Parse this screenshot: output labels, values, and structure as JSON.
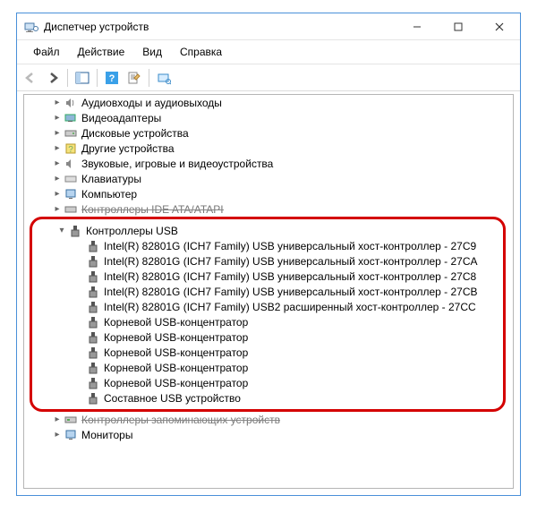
{
  "window": {
    "title": "Диспетчер устройств"
  },
  "menu": {
    "file": "Файл",
    "action": "Действие",
    "view": "Вид",
    "help": "Справка"
  },
  "tree": {
    "cat_audio": "Аудиовходы и аудиовыходы",
    "cat_video": "Видеоадаптеры",
    "cat_disk": "Дисковые устройства",
    "cat_other": "Другие устройства",
    "cat_sound": "Звуковые, игровые и видеоустройства",
    "cat_keyboard": "Клавиатуры",
    "cat_computer": "Компьютер",
    "cat_ide": "Контроллеры IDE ATA/ATAPI",
    "cat_usb": "Контроллеры USB",
    "cat_storage": "Контроллеры запоминающих устройств",
    "cat_monitor": "Мониторы",
    "usb_children": [
      "Intel(R) 82801G (ICH7 Family) USB универсальный хост-контроллер  - 27C9",
      "Intel(R) 82801G (ICH7 Family) USB универсальный хост-контроллер  - 27CA",
      "Intel(R) 82801G (ICH7 Family) USB универсальный хост-контроллер  - 27C8",
      "Intel(R) 82801G (ICH7 Family) USB универсальный хост-контроллер  - 27CB",
      "Intel(R) 82801G (ICH7 Family) USB2 расширенный хост-контроллер  - 27CC",
      "Корневой USB-концентратор",
      "Корневой USB-концентратор",
      "Корневой USB-концентратор",
      "Корневой USB-концентратор",
      "Корневой USB-концентратор",
      "Составное USB устройство"
    ]
  }
}
